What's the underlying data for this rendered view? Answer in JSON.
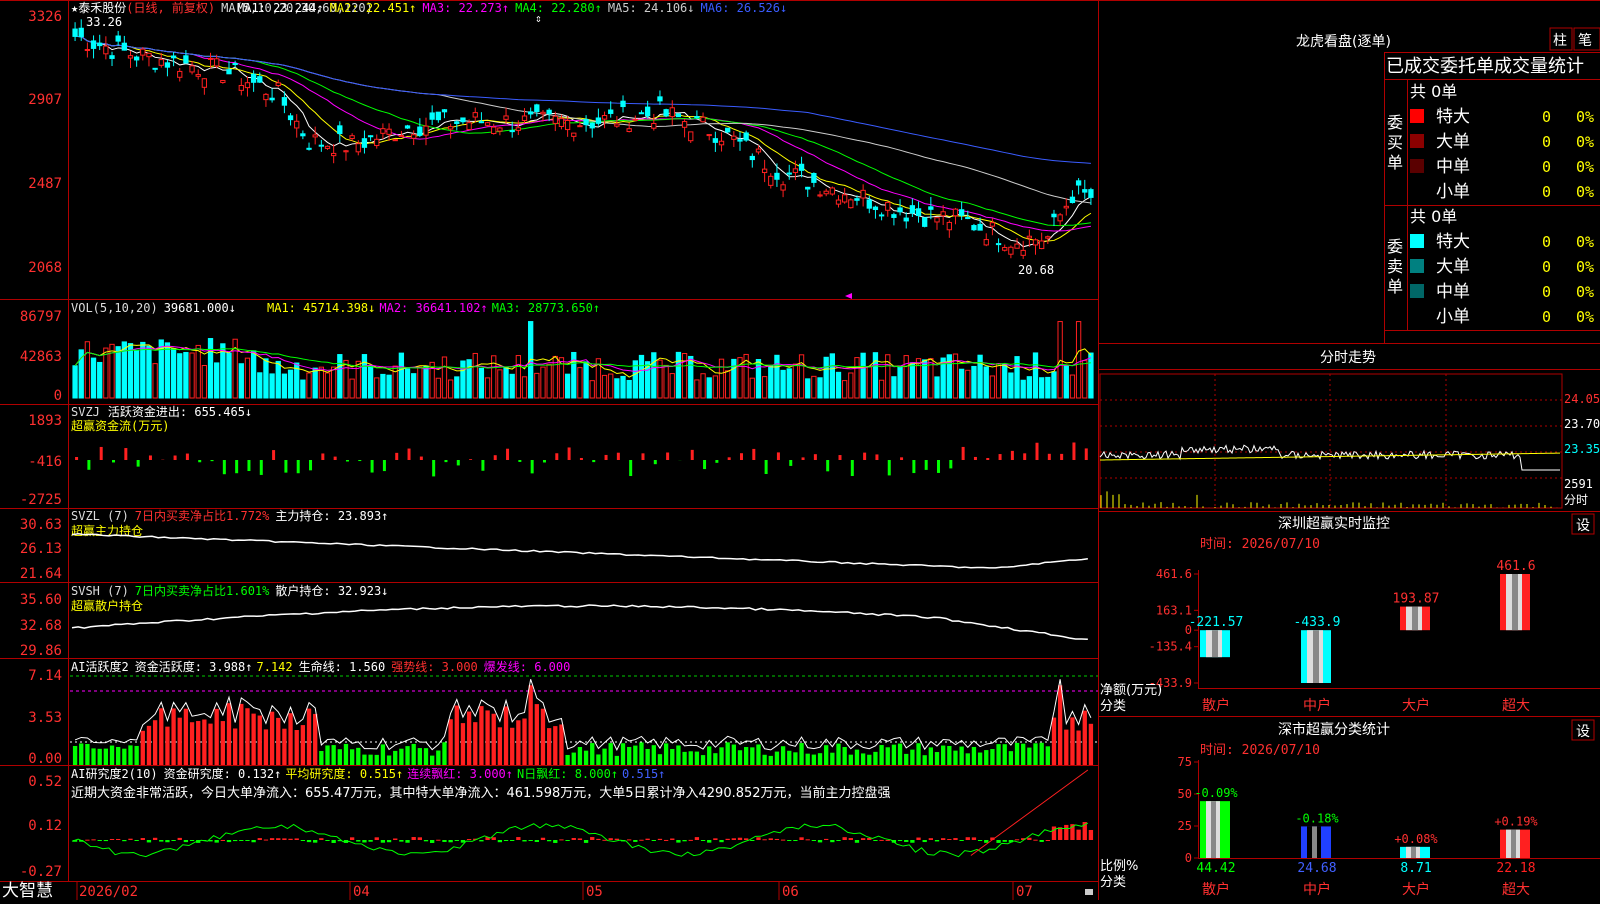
{
  "stock": {
    "star": "★",
    "name": "泰禾股份",
    "mode": "(日线, 前复权)",
    "ma_header": "MA(5,10,20,30,60,120)",
    "ma": [
      {
        "label": "MA1: 23.244↑",
        "color": "#ffffff"
      },
      {
        "label": "MA2: 22.451↑",
        "color": "#ffff00"
      },
      {
        "label": "MA3: 22.273↑",
        "color": "#ff00ff"
      },
      {
        "label": "MA4: 22.280↑",
        "color": "#00ff00"
      },
      {
        "label": "MA5: 24.106↓",
        "color": "#cccccc"
      },
      {
        "label": "MA6: 26.526↓",
        "color": "#3a5cff"
      }
    ],
    "high_mark": "33.26",
    "low_mark": "20.68",
    "axis_ticks": [
      "3326",
      "2907",
      "2487",
      "2068"
    ]
  },
  "volume": {
    "header": "VOL(5,10,20)",
    "value": "39681.000↓",
    "ma": [
      {
        "label": "MA1: 45714.398↓",
        "color": "#ffff00"
      },
      {
        "label": "MA2: 36641.102↑",
        "color": "#ff00ff"
      },
      {
        "label": "MA3: 28773.650↑",
        "color": "#00ff00"
      }
    ],
    "axis_ticks": [
      "86797",
      "42863",
      "0"
    ]
  },
  "svzj": {
    "header": "SVZJ",
    "line1": "活跃资金进出: 655.465↓",
    "line2": "超赢资金流(万元)",
    "axis_ticks": [
      "1893",
      "-416",
      "-2725"
    ]
  },
  "svzl": {
    "header": "SVZL (7)",
    "ratio": "7日内买卖净占比1.772%",
    "hold": "主力持仓: 23.893↑",
    "sub": "超赢主力持仓",
    "axis_ticks": [
      "30.63",
      "26.13",
      "21.64"
    ]
  },
  "svsh": {
    "header": "SVSH (7)",
    "ratio": "7日内买卖净占比1.601%",
    "hold": "散户持仓: 32.923↓",
    "sub": "超赢散户持仓",
    "axis_ticks": [
      "35.60",
      "32.68",
      "29.86"
    ]
  },
  "ai_active": {
    "header": "AI活跃度2",
    "v1": "资金活跃度: 3.988↑",
    "v2": "7.142",
    "v3": "生命线: 1.560",
    "v4": "强势线: 3.000",
    "v5": "爆发线: 6.000",
    "axis_ticks": [
      "7.14",
      "3.53",
      "0.00"
    ]
  },
  "ai_research": {
    "header": "AI研究度2(10)",
    "v1": "资金研究度: 0.132↑",
    "v2": "平均研究度: 0.515↑",
    "v3": "连续飘红: 3.000↑",
    "v4": "N日飘红: 8.000↑",
    "v5": "0.515↑",
    "note": "近期大资金非常活跃，今日大单净流入：655.47万元，其中特大单净流入：461.598万元，大单5日累计净入4290.852万元，当前主力控盘强",
    "axis_ticks": [
      "0.52",
      "0.12",
      "-0.27"
    ]
  },
  "xaxis": {
    "brand": "大智慧",
    "labels": [
      "2026/02",
      "04",
      "05",
      "06",
      "07"
    ]
  },
  "right": {
    "longhu_title": "龙虎看盘(逐单)",
    "btn_zhu": "柱",
    "btn_bi": "笔",
    "tabs_line": "已成交委托单成交量统计",
    "buy_label": "委买单",
    "sell_label": "委卖单",
    "buy_total": "共 0单",
    "sell_total": "共 0单",
    "buy_rows": [
      {
        "name": "特大",
        "count": "0",
        "pct": "0%",
        "color": "#ff0000"
      },
      {
        "name": "大单",
        "count": "0",
        "pct": "0%",
        "color": "#8b0000"
      },
      {
        "name": "中单",
        "count": "0",
        "pct": "0%",
        "color": "#5a0000"
      },
      {
        "name": "小单",
        "count": "0",
        "pct": "0%",
        "color": ""
      }
    ],
    "sell_rows": [
      {
        "name": "特大",
        "count": "0",
        "pct": "0%",
        "color": "#00ffff"
      },
      {
        "name": "大单",
        "count": "0",
        "pct": "0%",
        "color": "#008080"
      },
      {
        "name": "中单",
        "count": "0",
        "pct": "0%",
        "color": "#006666"
      },
      {
        "name": "小单",
        "count": "0",
        "pct": "0%",
        "color": ""
      }
    ],
    "intraday_title": "分时走势",
    "intraday_ticks": [
      "24.05",
      "23.70",
      "23.35"
    ],
    "intraday_vol": "2591",
    "intraday_label": "分时",
    "monitor_title": "深圳超赢实时监控",
    "monitor_btn": "设",
    "monitor_time": "时间: 2026/07/10",
    "monitor_axis": [
      "461.6",
      "163.1",
      "0",
      "-135.4",
      "-433.9"
    ],
    "monitor_side": [
      "净额(万元)",
      "分类"
    ],
    "classify_title": "深市超赢分类统计",
    "classify_btn": "设",
    "classify_time": "时间: 2026/07/10",
    "classify_axis": [
      "75",
      "50",
      "25",
      "0"
    ],
    "classify_side": [
      "比例%",
      "分类"
    ]
  },
  "chart_data": [
    {
      "type": "bar",
      "title": "深圳超赢实时监控",
      "ylabel": "净额(万元)",
      "categories": [
        "散户",
        "中户",
        "大户",
        "超大"
      ],
      "values": [
        -221.57,
        -433.9,
        193.87,
        461.6
      ],
      "labels": [
        "-221.57",
        "-433.9",
        "193.87",
        "461.6"
      ],
      "ylim": [
        -433.9,
        461.6
      ]
    },
    {
      "type": "bar",
      "title": "深市超赢分类统计",
      "ylabel": "比例%",
      "categories": [
        "散户",
        "中户",
        "大户",
        "超大"
      ],
      "values": [
        44.42,
        24.68,
        8.71,
        22.18
      ],
      "top_labels": [
        "-0.09%",
        "-0.18%",
        "+0.08%",
        "+0.19%"
      ],
      "bottom_labels": [
        "44.42",
        "24.68",
        "8.71",
        "22.18"
      ],
      "ylim": [
        0,
        75
      ]
    }
  ]
}
